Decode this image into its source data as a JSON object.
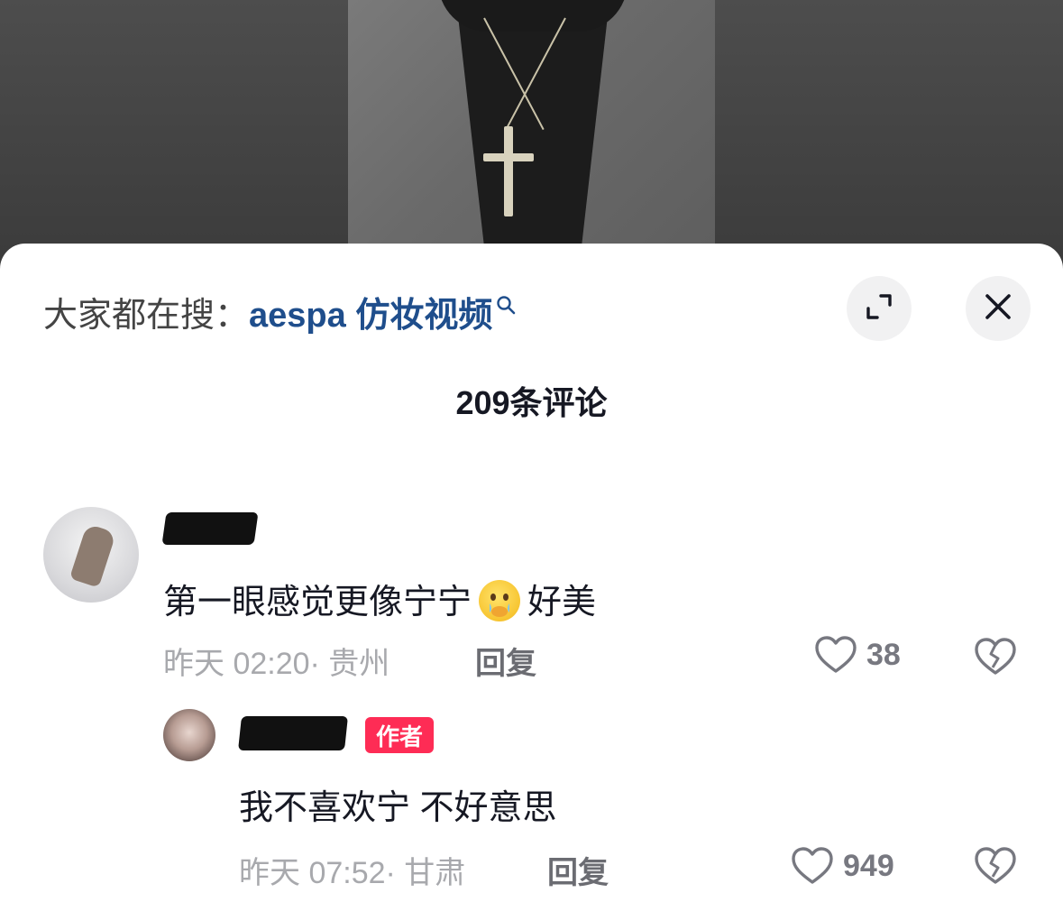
{
  "search_hint": {
    "prefix": "大家都在搜：",
    "keyword": "aespa 仿妆视频"
  },
  "comment_count": "209条评论",
  "comments": [
    {
      "text_before_emoji": "第一眼感觉更像宁宁",
      "emoji": "face-holding-back-tears-emoji",
      "text_after_emoji": "好美",
      "meta": "昨天 02:20· 贵州",
      "reply_label": "回复",
      "likes": "38"
    },
    {
      "badge": "作者",
      "text": "我不喜欢宁 不好意思",
      "meta": "昨天 07:52· 甘肃",
      "reply_label": "回复",
      "likes": "949"
    }
  ],
  "icons": {
    "expand": "expand-icon",
    "close": "close-icon",
    "like": "heart-icon",
    "dislike": "broken-heart-icon",
    "search": "search-icon"
  },
  "colors": {
    "accent_link": "#1f4e8c",
    "author_badge": "#fe2c55",
    "text_primary": "#161823",
    "text_secondary": "#a8a9ad"
  }
}
